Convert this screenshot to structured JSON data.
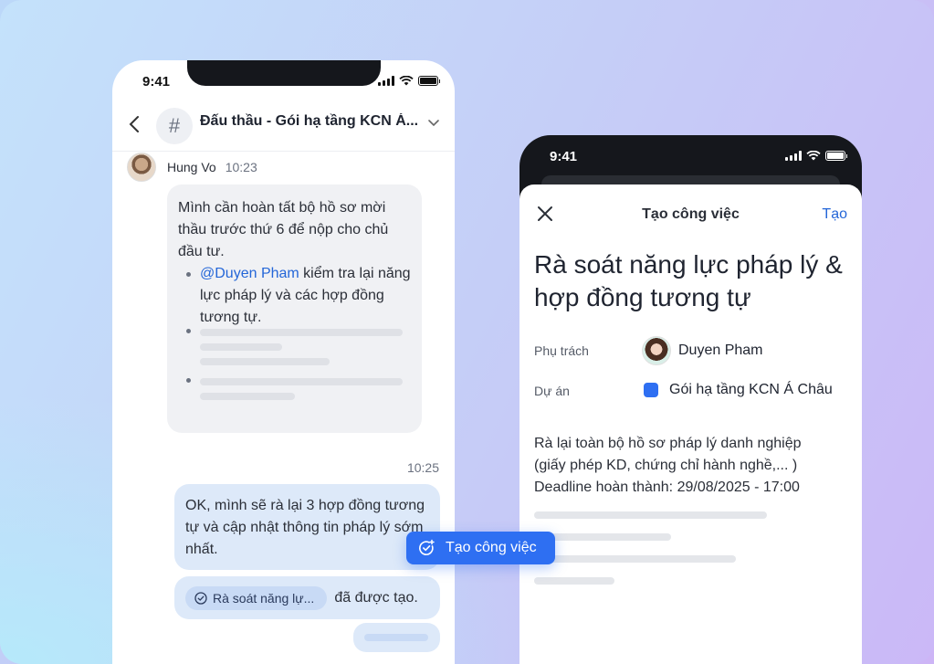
{
  "left_phone": {
    "status_time": "9:41",
    "channel_title": "Đấu thầu - Gói hạ tầng KCN Á...",
    "message_1": {
      "author": "Hung Vo",
      "time": "10:23",
      "text": "Mình cần hoàn tất bộ hồ sơ mời thầu trước thứ 6 để nộp cho chủ đầu tư.",
      "mention": "@Duyen Pham",
      "bullet_text": " kiểm tra lại năng lực pháp lý và các hợp đồng tương tự."
    },
    "message_2": {
      "time": "10:25",
      "text": "OK, mình sẽ rà lại 3 hợp đồng tương tự và cập nhật thông tin pháp lý sớm nhất."
    },
    "task_notice": {
      "chip_label": "Rà soát năng lự...",
      "suffix": "đã được tạo."
    }
  },
  "floating_button": {
    "label": "Tạo công việc",
    "icon": "task-add-icon"
  },
  "right_phone": {
    "status_time": "9:41",
    "sheet": {
      "title": "Tạo công việc",
      "create_label": "Tạo",
      "task_title": "Rà soát năng lực pháp lý & hợp đồng tương tự",
      "assignee_label": "Phụ trách",
      "assignee_value": "Duyen Pham",
      "project_label": "Dự án",
      "project_value": "Gói hạ tầng KCN Á Châu",
      "project_color": "#2e6ff2",
      "description_lines": [
        "Rà lại toàn bộ hồ sơ pháp lý danh nghiệp",
        "(giấy phép KD, chứng chỉ hành nghề,... )",
        "Deadline hoàn thành: 29/08/2025 - 17:00"
      ]
    }
  },
  "colors": {
    "accent": "#2e6ff2",
    "link": "#2466d8",
    "bubble_out": "#dde9f9",
    "bubble_in": "#f0f1f4"
  }
}
